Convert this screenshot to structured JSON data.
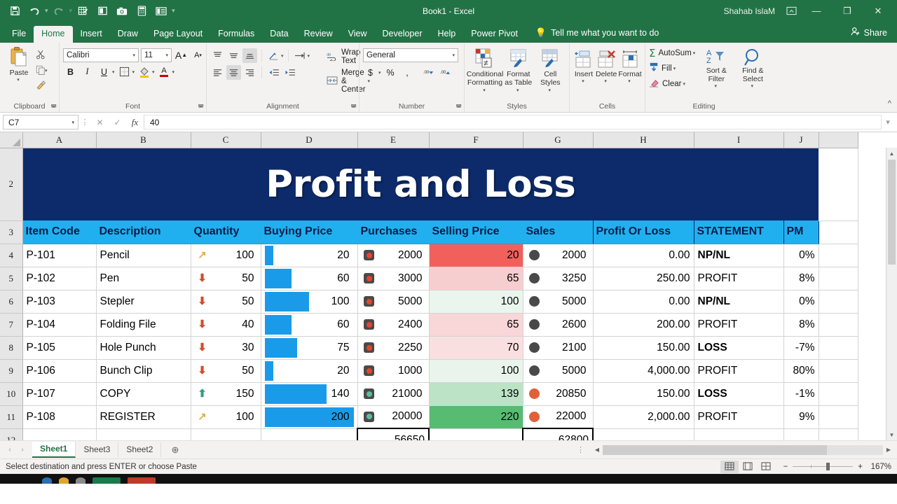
{
  "window": {
    "title": "Book1  -  Excel",
    "user": "Shahab IslaM",
    "ribbon_display_icon": "ribbon-display-options-icon",
    "minimize": "—",
    "restore": "❐",
    "close": "✕"
  },
  "quick_access": [
    {
      "name": "save-icon",
      "glyph": "save"
    },
    {
      "name": "undo-icon",
      "glyph": "undo"
    },
    {
      "name": "redo-icon",
      "glyph": "redo"
    },
    {
      "name": "spelling-icon",
      "glyph": "grid-pencil"
    },
    {
      "name": "print-preview-icon",
      "glyph": "page"
    },
    {
      "name": "camera-icon",
      "glyph": "camera"
    },
    {
      "name": "calculator-icon",
      "glyph": "calculator"
    },
    {
      "name": "form-icon",
      "glyph": "form"
    },
    {
      "name": "customize-qat-icon",
      "glyph": "chevron"
    }
  ],
  "tabs": [
    {
      "label": "File",
      "active": false
    },
    {
      "label": "Home",
      "active": true
    },
    {
      "label": "Insert",
      "active": false
    },
    {
      "label": "Draw",
      "active": false
    },
    {
      "label": "Page Layout",
      "active": false
    },
    {
      "label": "Formulas",
      "active": false
    },
    {
      "label": "Data",
      "active": false
    },
    {
      "label": "Review",
      "active": false
    },
    {
      "label": "View",
      "active": false
    },
    {
      "label": "Developer",
      "active": false
    },
    {
      "label": "Help",
      "active": false
    },
    {
      "label": "Power Pivot",
      "active": false
    }
  ],
  "tell_me": "Tell me what you want to do",
  "share": "Share",
  "ribbon": {
    "clipboard": {
      "label": "Clipboard",
      "paste": "Paste",
      "cut": "Cut",
      "copy": "Copy",
      "format_painter": "Format Painter"
    },
    "font": {
      "label": "Font",
      "font_name": "Calibri",
      "font_size": "11",
      "grow": "A",
      "shrink": "A",
      "bold": "B",
      "italic": "I",
      "underline": "U",
      "borders": "borders",
      "fill_color": "fill-color",
      "font_color": "A"
    },
    "alignment": {
      "label": "Alignment",
      "wrap_text": "Wrap Text",
      "merge_center": "Merge & Center"
    },
    "number": {
      "label": "Number",
      "format": "General",
      "currency": "$",
      "percent": "%",
      "comma": ",",
      "increase_decimal": ".00",
      "decrease_decimal": ".00"
    },
    "styles": {
      "label": "Styles",
      "conditional_formatting": "Conditional Formatting",
      "format_as_table": "Format as Table",
      "cell_styles": "Cell Styles"
    },
    "cells": {
      "label": "Cells",
      "insert": "Insert",
      "delete": "Delete",
      "format": "Format"
    },
    "editing": {
      "label": "Editing",
      "autosum": "AutoSum",
      "fill": "Fill",
      "clear": "Clear",
      "sort_filter": "Sort & Filter",
      "find_select": "Find & Select"
    }
  },
  "formula_bar": {
    "name_box": "C7",
    "cancel": "✕",
    "enter": "✓",
    "fx": "fx",
    "value": "40"
  },
  "sheet": {
    "columns": [
      "A",
      "B",
      "C",
      "D",
      "E",
      "F",
      "G",
      "H",
      "I",
      "J"
    ],
    "row_numbers": [
      "2",
      "3",
      "4",
      "5",
      "6",
      "7",
      "8",
      "9",
      "10",
      "11",
      "12"
    ],
    "banner_title": "Profit and Loss",
    "headers": [
      "Item Code",
      "Description",
      "Quantity",
      "Buying Price",
      "Purchases",
      "Selling Price",
      "Sales",
      "Profit Or Loss",
      "STATEMENT",
      "PM"
    ],
    "rows": [
      {
        "row": "4",
        "item_code": "P-101",
        "description": "Pencil",
        "quantity": "100",
        "qty_icon": "arrow-up-right-yellow",
        "buying_price": "20",
        "bar_pct": 10,
        "purchases": "2000",
        "purch_icon": "traffic-light-red",
        "selling_price": "20",
        "sell_bg": "#f2605c",
        "sales": "2000",
        "sales_icon": "circle-gray",
        "profit_or_loss": "0.00",
        "pl_red": false,
        "statement": "NP/NL",
        "statement_style": "np",
        "pm": "0%"
      },
      {
        "row": "5",
        "item_code": "P-102",
        "description": "Pen",
        "quantity": "50",
        "qty_icon": "arrow-down-red",
        "buying_price": "60",
        "bar_pct": 30,
        "purchases": "3000",
        "purch_icon": "traffic-light-red",
        "selling_price": "65",
        "sell_bg": "#f7ced0",
        "sales": "3250",
        "sales_icon": "circle-gray",
        "profit_or_loss": "250.00",
        "pl_red": false,
        "statement": "PROFIT",
        "statement_style": "profit",
        "pm": "8%"
      },
      {
        "row": "6",
        "item_code": "P-103",
        "description": "Stepler",
        "quantity": "50",
        "qty_icon": "arrow-down-red",
        "buying_price": "100",
        "bar_pct": 50,
        "purchases": "5000",
        "purch_icon": "traffic-light-red",
        "selling_price": "100",
        "sell_bg": "#eaf5ee",
        "sales": "5000",
        "sales_icon": "circle-gray",
        "profit_or_loss": "0.00",
        "pl_red": false,
        "statement": "NP/NL",
        "statement_style": "np",
        "pm": "0%"
      },
      {
        "row": "7",
        "item_code": "P-104",
        "description": "Folding File",
        "quantity": "40",
        "qty_icon": "arrow-down-red",
        "buying_price": "60",
        "bar_pct": 30,
        "purchases": "2400",
        "purch_icon": "traffic-light-red",
        "selling_price": "65",
        "sell_bg": "#f9d6d8",
        "sales": "2600",
        "sales_icon": "circle-gray",
        "profit_or_loss": "200.00",
        "pl_red": false,
        "statement": "PROFIT",
        "statement_style": "profit",
        "pm": "8%"
      },
      {
        "row": "8",
        "item_code": "P-105",
        "description": "Hole Punch",
        "quantity": "30",
        "qty_icon": "arrow-down-red",
        "buying_price": "75",
        "bar_pct": 37,
        "purchases": "2250",
        "purch_icon": "traffic-light-red",
        "selling_price": "70",
        "sell_bg": "#fadfe1",
        "sales": "2100",
        "sales_icon": "circle-gray",
        "profit_or_loss": "150.00",
        "pl_red": true,
        "statement": "LOSS",
        "statement_style": "loss",
        "pm": "-7%"
      },
      {
        "row": "9",
        "item_code": "P-106",
        "description": "Bunch Clip",
        "quantity": "50",
        "qty_icon": "arrow-down-red",
        "buying_price": "20",
        "bar_pct": 10,
        "purchases": "1000",
        "purch_icon": "traffic-light-red",
        "selling_price": "100",
        "sell_bg": "#e9f5ec",
        "sales": "5000",
        "sales_icon": "circle-gray",
        "profit_or_loss": "4,000.00",
        "pl_red": false,
        "statement": "PROFIT",
        "statement_style": "profit",
        "pm": "80%"
      },
      {
        "row": "10",
        "item_code": "P-107",
        "description": "COPY",
        "quantity": "150",
        "qty_icon": "arrow-up-green",
        "buying_price": "140",
        "bar_pct": 70,
        "purchases": "21000",
        "purch_icon": "traffic-light-green",
        "selling_price": "139",
        "sell_bg": "#bce3c6",
        "sales": "20850",
        "sales_icon": "circle-orange",
        "profit_or_loss": "150.00",
        "pl_red": true,
        "statement": "LOSS",
        "statement_style": "loss",
        "pm": "-1%"
      },
      {
        "row": "11",
        "item_code": "P-108",
        "description": "REGISTER",
        "quantity": "100",
        "qty_icon": "arrow-up-right-yellow",
        "buying_price": "200",
        "bar_pct": 100,
        "purchases": "20000",
        "purch_icon": "traffic-light-green",
        "selling_price": "220",
        "sell_bg": "#57bb72",
        "sales": "22000",
        "sales_icon": "circle-orange",
        "profit_or_loss": "2,000.00",
        "pl_red": false,
        "statement": "PROFIT",
        "statement_style": "profit",
        "pm": "9%"
      }
    ],
    "totals": {
      "row": "12",
      "purchases_total": "56650",
      "sales_total": "62800"
    }
  },
  "sheet_tabs": {
    "prev": "‹",
    "next": "›",
    "items": [
      {
        "label": "Sheet1",
        "active": true
      },
      {
        "label": "Sheet3",
        "active": false
      },
      {
        "label": "Sheet2",
        "active": false
      }
    ],
    "add": "⊕"
  },
  "status": {
    "message": "Select destination and press ENTER or choose Paste",
    "view_normal": "normal-view-icon",
    "view_page_layout": "page-layout-view-icon",
    "view_page_break": "page-break-view-icon",
    "zoom_out": "−",
    "zoom_in": "+",
    "zoom_level": "167%"
  },
  "colors": {
    "excel_green": "#217346",
    "header_blue": "#21b0ef",
    "banner_navy": "#0d2b6b",
    "loss_red": "#cc0000",
    "data_bar": "#1a9bea"
  }
}
